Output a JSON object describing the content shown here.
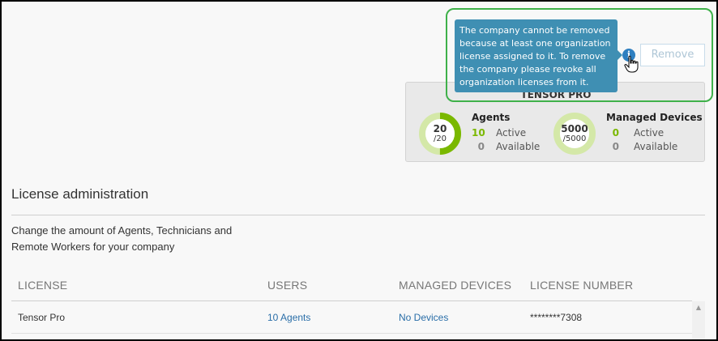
{
  "tooltip": {
    "text": "The company cannot be removed because at least one organization license assigned to it. To remove the company please revoke all organization licenses from it."
  },
  "actions": {
    "remove_label": "Remove"
  },
  "license_card": {
    "title": "TENSOR PRO",
    "agents": {
      "title": "Agents",
      "used": "20",
      "total": "/20",
      "active_count": "10",
      "active_label": "Active",
      "available_count": "0",
      "available_label": "Available",
      "fill_fraction": 0.5
    },
    "devices": {
      "title": "Managed Devices",
      "used": "5000",
      "total": "/5000",
      "active_count": "0",
      "active_label": "Active",
      "available_count": "0",
      "available_label": "Available",
      "fill_fraction": 0.0
    },
    "colors": {
      "active": "#7ab800",
      "ring_bg": "#d4e8a8",
      "available": "#888888"
    }
  },
  "section": {
    "title": "License administration",
    "description": "Change the amount of Agents, Technicians and Remote Workers for your company"
  },
  "table": {
    "headers": [
      "LICENSE",
      "USERS",
      "MANAGED DEVICES",
      "LICENSE NUMBER"
    ],
    "rows": [
      [
        "Tensor Pro",
        "10 Agents",
        "No Devices",
        "********7308"
      ]
    ]
  }
}
